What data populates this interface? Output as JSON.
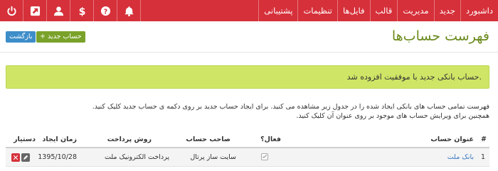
{
  "nav": {
    "menu": [
      "داشبورد",
      "جدید",
      "مدیریت",
      "قالب",
      "فایل‌ها",
      "تنظیمات",
      "پشتیبانی"
    ],
    "icons": [
      "power-icon",
      "user-icon",
      "dollar-icon",
      "help-icon",
      "bell-icon",
      "external-link-icon"
    ]
  },
  "header": {
    "title": "فهرست حساب‌ها",
    "new_button": "+ حساب جدید",
    "back_button": "بازگشت"
  },
  "alert": {
    "message": "حساب بانکی جدید با موفقیت افزوده شد."
  },
  "description": {
    "line1": "فهرست تمامی حساب های بانکی ایجاد شده را در جدول زیر مشاهده می کنید. برای ایجاد حساب جدید بر روی دکمه ی حساب جدید کلیک کنید.",
    "line2": "همچنین برای ویرایش حساب های موجود بر روی عنوان آن کلیک کنید."
  },
  "table": {
    "headers": {
      "index": "#",
      "title": "عنوان حساب",
      "active": "فعال؟",
      "owner": "صاحب حساب",
      "method": "روش پرداخت",
      "created": "زمان ایجاد",
      "tools": "دستیار"
    },
    "rows": [
      {
        "index": "1",
        "title": "بانک ملت",
        "active": true,
        "owner": "سایت ساز پرتال",
        "method": "پرداخت الکترونیک ملت",
        "created": "1395/10/28"
      }
    ]
  },
  "colors": {
    "navbar": "#d6303a",
    "title": "#6a8a1c",
    "alert": "#cfe566",
    "new_button": "#7aa22a",
    "back_button": "#3d8dc9"
  }
}
